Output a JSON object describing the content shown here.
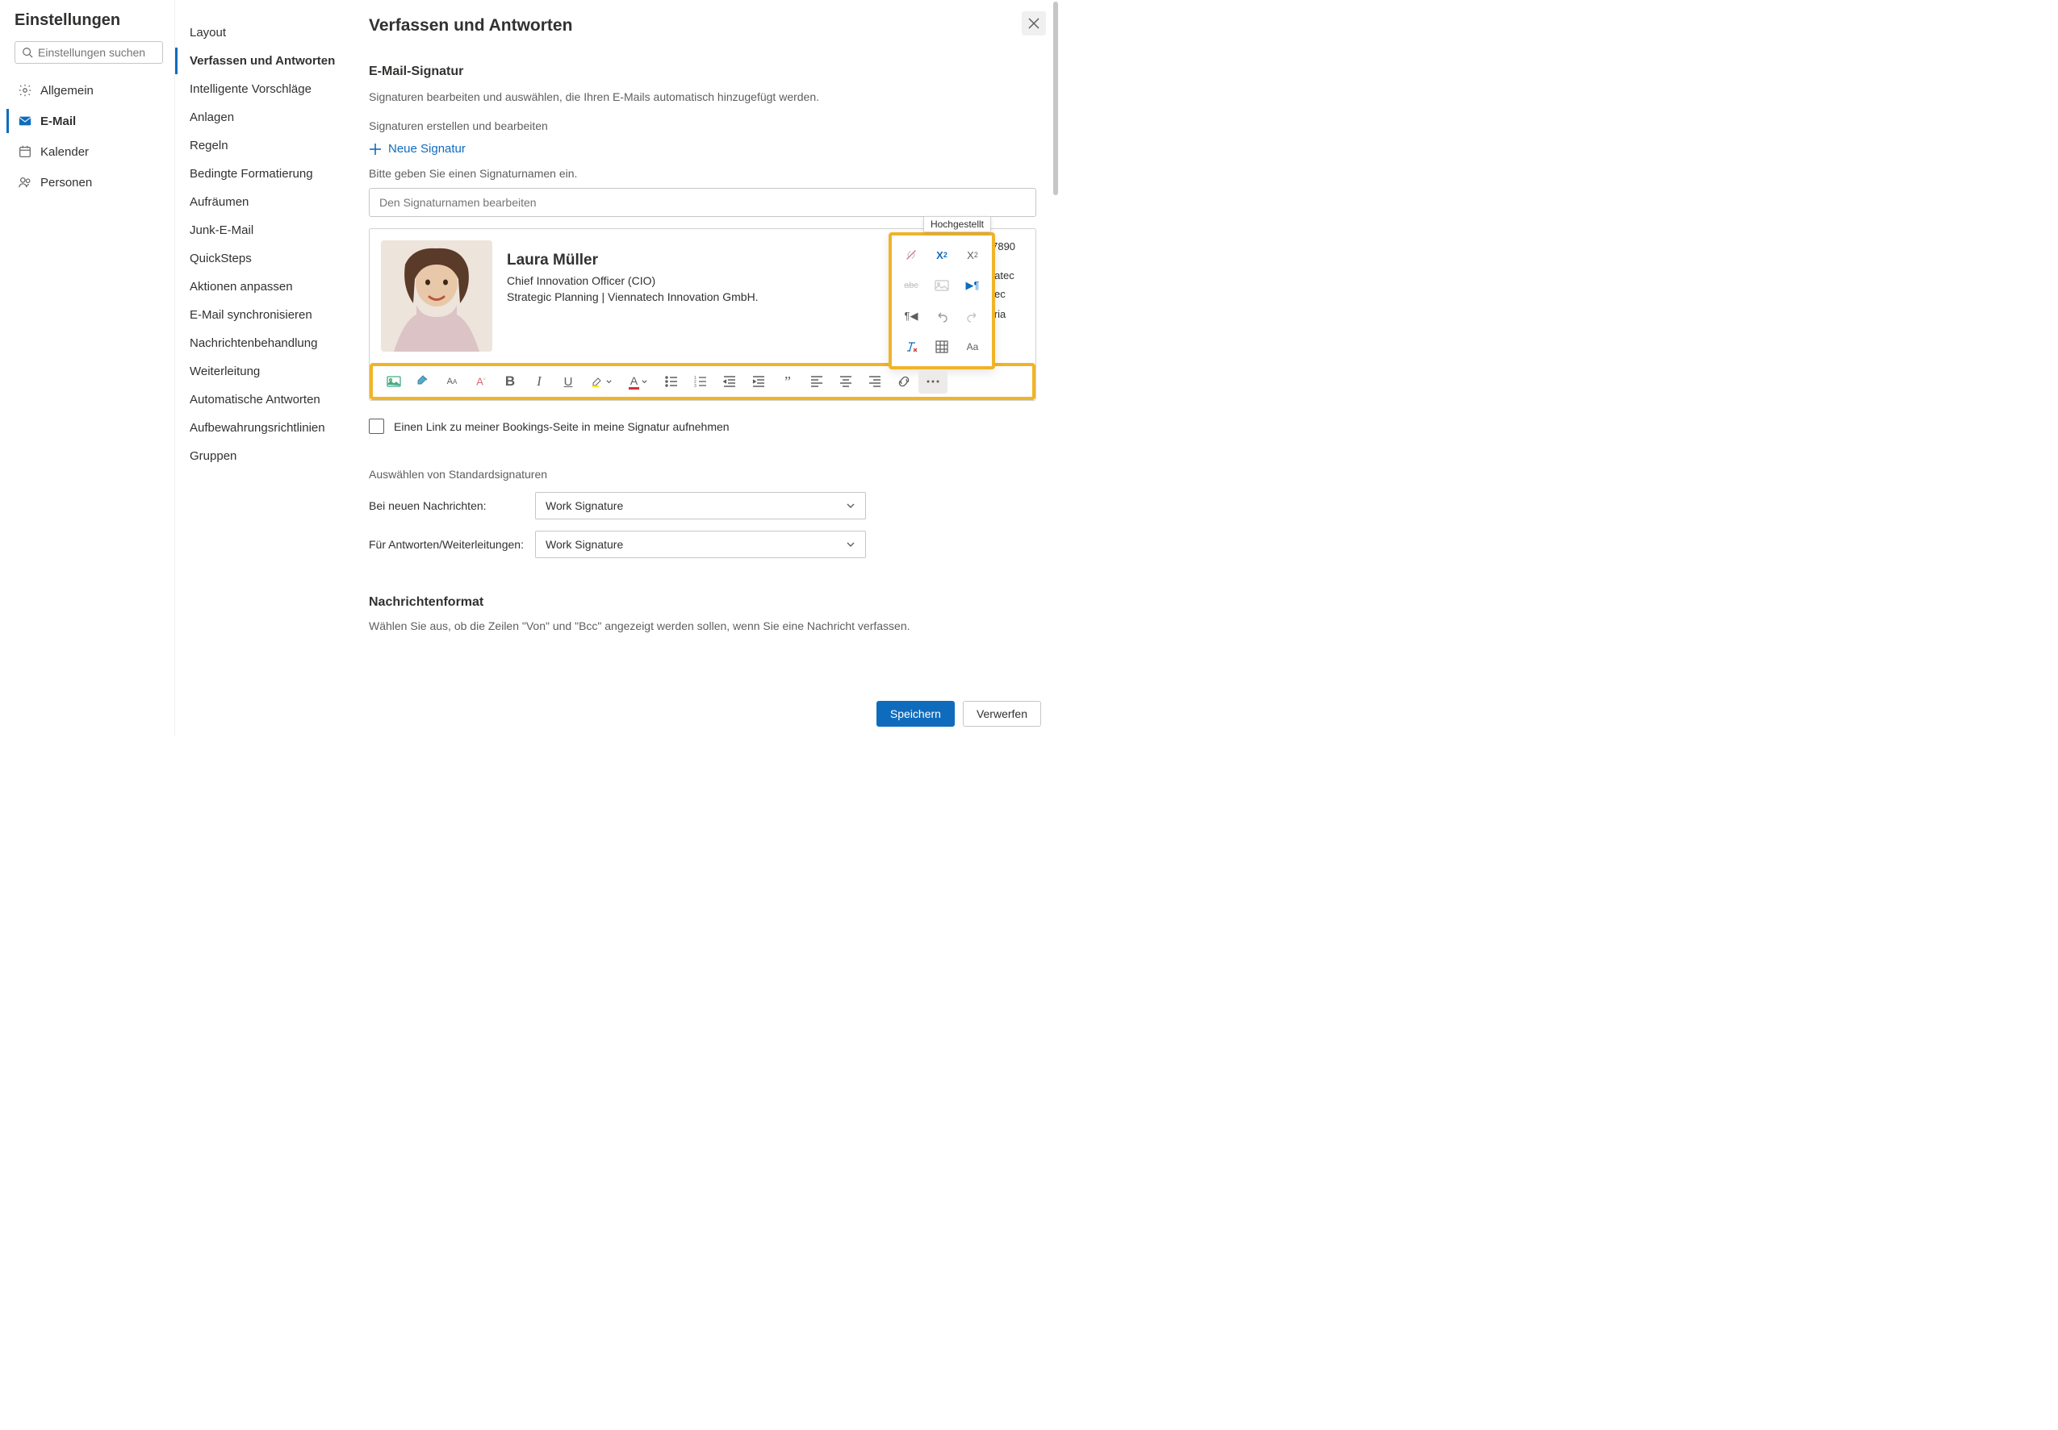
{
  "col1": {
    "title": "Einstellungen",
    "search_placeholder": "Einstellungen suchen",
    "categories": [
      {
        "label": "Allgemein"
      },
      {
        "label": "E-Mail"
      },
      {
        "label": "Kalender"
      },
      {
        "label": "Personen"
      }
    ]
  },
  "col2": {
    "items": [
      "Layout",
      "Verfassen und Antworten",
      "Intelligente Vorschläge",
      "Anlagen",
      "Regeln",
      "Bedingte Formatierung",
      "Aufräumen",
      "Junk-E-Mail",
      "QuickSteps",
      "Aktionen anpassen",
      "E-Mail synchronisieren",
      "Nachrichtenbehandlung",
      "Weiterleitung",
      "Automatische Antworten",
      "Aufbewahrungsrichtlinien",
      "Gruppen"
    ]
  },
  "main": {
    "title": "Verfassen und Antworten",
    "sig_heading": "E-Mail-Signatur",
    "sig_desc": "Signaturen bearbeiten und auswählen, die Ihren E-Mails automatisch hinzugefügt werden.",
    "sig_sub": "Signaturen erstellen und bearbeiten",
    "new_sig": "Neue Signatur",
    "name_prompt": "Bitte geben Sie einen Signaturnamen ein.",
    "name_placeholder": "Den Signaturnamen bearbeiten",
    "signature": {
      "name": "Laura Müller",
      "role": "Chief Innovation Officer (CIO)",
      "dept": "Strategic Planning | Viennatech Innovation GmbH.",
      "phone": "06 123-456-7890 7890",
      "email": "laura@viennatec",
      "web": "www.viennatec",
      "loc": "Vienna, Austria"
    },
    "tooltip": "Hochgestellt",
    "bookings_label": "Einen Link zu meiner Bookings-Seite in meine Signatur aufnehmen",
    "defaults_heading": "Auswählen von Standardsignaturen",
    "new_msg_label": "Bei neuen Nachrichten:",
    "reply_label": "Für Antworten/Weiterleitungen:",
    "selected_sig": "Work Signature",
    "format_heading": "Nachrichtenformat",
    "format_desc": "Wählen Sie aus, ob die Zeilen \"Von\" und \"Bcc\" angezeigt werden sollen, wenn Sie eine Nachricht verfassen.",
    "save": "Speichern",
    "discard": "Verwerfen"
  }
}
